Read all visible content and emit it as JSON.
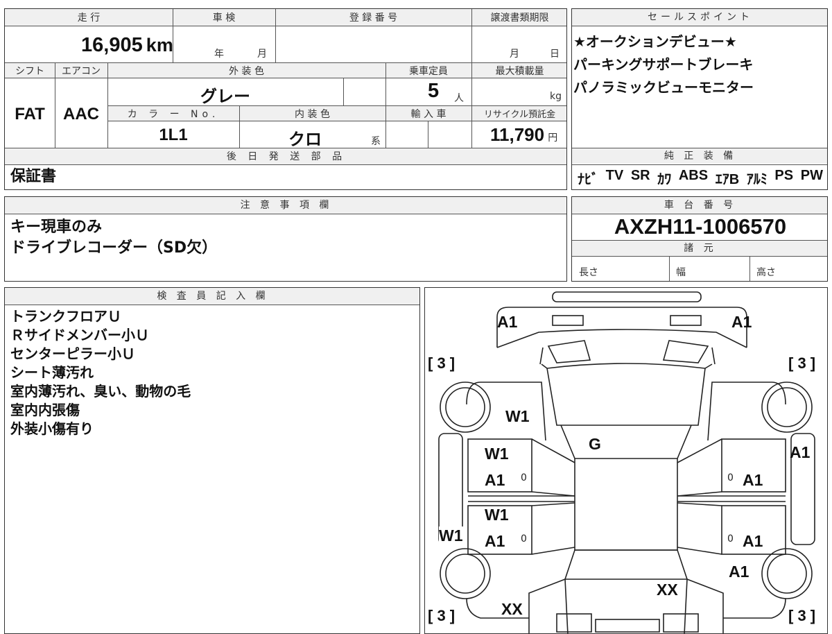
{
  "vehicle": {
    "labels": {
      "mileage": "走 行",
      "inspection": "車 検",
      "registration": "登 録 番 号",
      "transfer_deadline": "譲渡書類期限",
      "shift": "シフト",
      "aircon": "エアコン",
      "exterior_color": "外 装 色",
      "capacity": "乗車定員",
      "max_load": "最大積載量",
      "color_no": "カ ラ ー No.",
      "interior_color": "内 装 色",
      "import": "輸 入 車",
      "recycle_fee": "リサイクル預託金"
    },
    "mileage": "16,905",
    "mileage_unit": "km",
    "inspection_year": "年",
    "inspection_month": "月",
    "transfer_month": "月",
    "transfer_day": "日",
    "shift": "FAT",
    "aircon": "AAC",
    "exterior_color": "グレー",
    "capacity": "5",
    "capacity_unit": "人",
    "max_load_unit": "kg",
    "color_no": "1L1",
    "interior_color": "クロ",
    "interior_suffix": "系",
    "recycle_fee": "11,790",
    "recycle_unit": "円"
  },
  "deferred_parts": {
    "label": "後 日 発 送 部 品",
    "value": "保証書"
  },
  "sales_points": {
    "label": "セールスポイント",
    "items": [
      "★オークションデビュー★",
      "パーキングサポートブレーキ",
      "パノラミックビューモニター"
    ]
  },
  "equipment": {
    "label": "純 正 装 備",
    "items": [
      "ﾅﾋﾞ",
      "TV",
      "SR",
      "ｶﾜ",
      "ABS",
      "ｴｱB",
      "ｱﾙﾐ",
      "PS",
      "PW"
    ]
  },
  "notes": {
    "label": "注 意 事 項 欄",
    "lines": [
      "キー現車のみ",
      "ドライブレコーダー（SD欠）"
    ]
  },
  "chassis": {
    "label": "車 台 番 号",
    "number": "AXZH11-1006570",
    "specs_label": "諸 元",
    "length": "長さ",
    "width": "幅",
    "height": "高さ"
  },
  "inspector": {
    "label": "検 査 員 記 入 欄",
    "lines": [
      "トランクフロアＵ",
      "Ｒサイドメンバー小Ｕ",
      "センターピラー小Ｕ",
      "シート薄汚れ",
      "室内薄汚れ、臭い、動物の毛",
      "室内内張傷",
      "外装小傷有り"
    ]
  },
  "diagram": {
    "marks": {
      "rear_left": "A1",
      "rear_right": "A1",
      "trunk": "W1",
      "glass": "G",
      "rear_door_left_1": "W1",
      "rear_door_left_2": "A1",
      "front_door_left_1": "W1",
      "front_door_left_2": "A1",
      "rear_door_right": "A1",
      "front_door_right": "A1",
      "quarter_right": "A1",
      "side_left": "W1",
      "fender_right": "A1",
      "hood": "XX",
      "front_left": "XX"
    },
    "tyres": {
      "rear_left": "[ 3 ]",
      "rear_right": "[ 3 ]",
      "front_left": "[ 3 ]",
      "front_right": "[ 3 ]"
    },
    "zero": "0"
  }
}
